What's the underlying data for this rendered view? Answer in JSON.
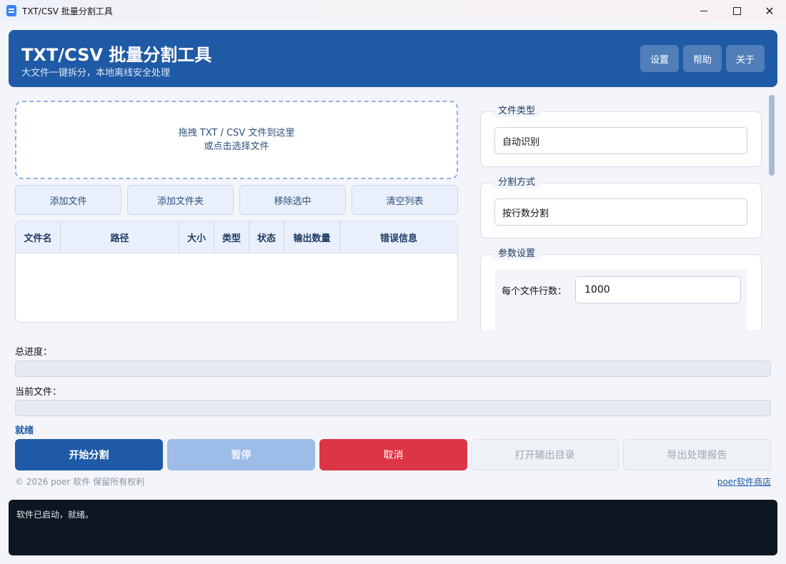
{
  "window": {
    "title": "TXT/CSV 批量分割工具"
  },
  "header": {
    "title": "TXT/CSV 批量分割工具",
    "subtitle": "大文件一键拆分，本地离线安全处理",
    "buttons": [
      "设置",
      "帮助",
      "关于"
    ]
  },
  "dropzone": {
    "line1": "拖拽 TXT / CSV 文件到这里",
    "line2": "或点击选择文件"
  },
  "file_buttons": [
    "添加文件",
    "添加文件夹",
    "移除选中",
    "清空列表"
  ],
  "table": {
    "columns": [
      "文件名",
      "路径",
      "大小",
      "类型",
      "状态",
      "输出数量",
      "错误信息"
    ]
  },
  "settings": {
    "file_type": {
      "label": "文件类型",
      "value": "自动识别"
    },
    "split_mode": {
      "label": "分割方式",
      "value": "按行数分割"
    },
    "params": {
      "label": "参数设置",
      "lines_label": "每个文件行数：",
      "lines_value": "1000"
    }
  },
  "progress": {
    "total_label": "总进度：",
    "current_label": "当前文件：",
    "total": 0,
    "current": 0
  },
  "status": "就绪",
  "actions": {
    "start": "开始分割",
    "pause": "暂停",
    "cancel": "取消",
    "open_output": "打开输出目录",
    "export_report": "导出处理报告"
  },
  "footer": {
    "copyright": "© 2026 poer 软件  保留所有权利",
    "store_link": "poer软件商店"
  },
  "log": {
    "text": "软件已启动，就绪。"
  }
}
